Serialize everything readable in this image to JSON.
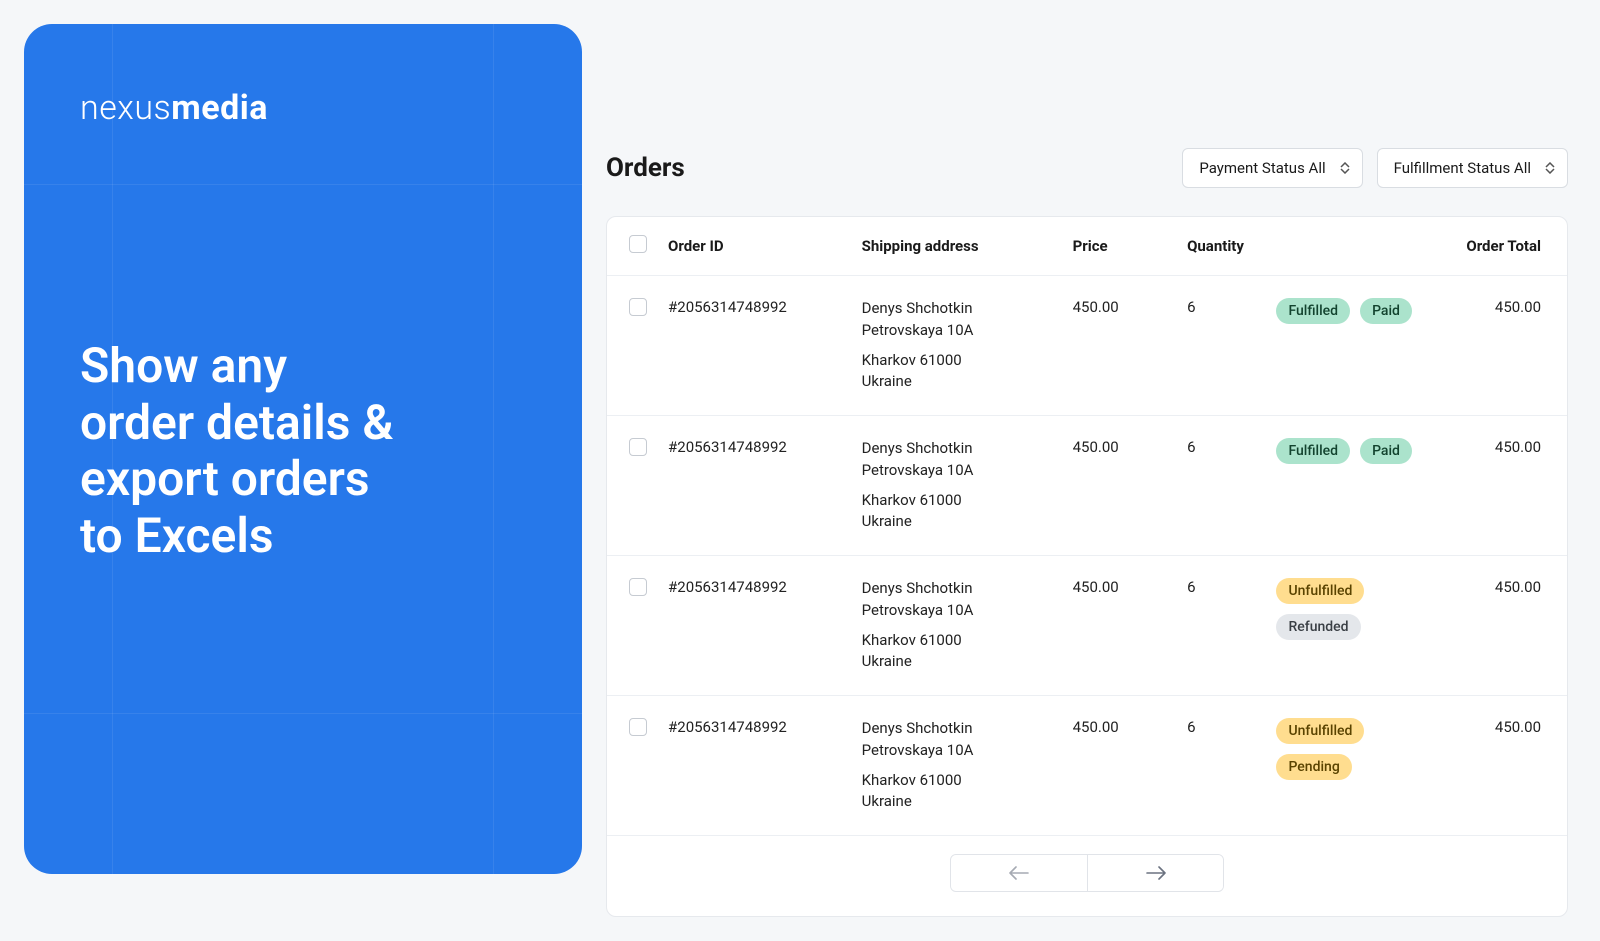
{
  "promo": {
    "brand_light": "nexus",
    "brand_bold": "media",
    "copy": "Show any\norder details &\nexport orders\nto Excels"
  },
  "header": {
    "title": "Orders",
    "filters": {
      "payment": "Payment Status All",
      "fulfillment": "Fulfillment Status All"
    }
  },
  "columns": {
    "order_id": "Order ID",
    "shipping": "Shipping address",
    "price": "Price",
    "quantity": "Quantity",
    "order_total": "Order Total"
  },
  "tag_colors": {
    "Fulfilled": "tag-green",
    "Paid": "tag-green",
    "Unfulfilled": "tag-yellow",
    "Refunded": "tag-grey",
    "Pending": "tag-yellow"
  },
  "orders": [
    {
      "id": "#2056314748992",
      "address": [
        "Denys Shchotkin",
        "Petrovskaya 10A",
        "",
        "Kharkov 61000",
        "Ukraine"
      ],
      "price": "450.00",
      "qty": "6",
      "tags": [
        "Fulfilled",
        "Paid"
      ],
      "total": "450.00"
    },
    {
      "id": "#2056314748992",
      "address": [
        "Denys Shchotkin",
        "Petrovskaya 10A",
        "",
        "Kharkov 61000",
        "Ukraine"
      ],
      "price": "450.00",
      "qty": "6",
      "tags": [
        "Fulfilled",
        "Paid"
      ],
      "total": "450.00"
    },
    {
      "id": "#2056314748992",
      "address": [
        "Denys Shchotkin",
        "Petrovskaya 10A",
        "",
        "Kharkov 61000",
        "Ukraine"
      ],
      "price": "450.00",
      "qty": "6",
      "tags": [
        "Unfulfilled",
        "Refunded"
      ],
      "total": "450.00"
    },
    {
      "id": "#2056314748992",
      "address": [
        "Denys Shchotkin",
        "Petrovskaya 10A",
        "",
        "Kharkov 61000",
        "Ukraine"
      ],
      "price": "450.00",
      "qty": "6",
      "tags": [
        "Unfulfilled",
        "Pending"
      ],
      "total": "450.00"
    }
  ]
}
